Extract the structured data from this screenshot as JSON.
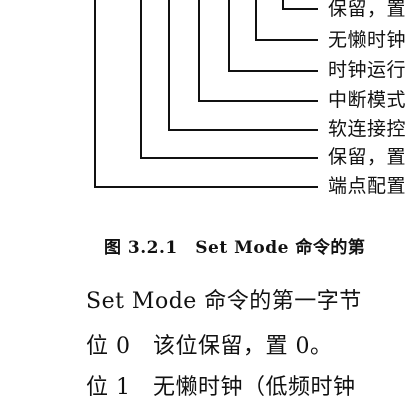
{
  "diagram": {
    "labels": [
      "保留，置",
      "无懒时钟",
      "时钟运行",
      "中断模式",
      "软连接控",
      "保留，置",
      "端点配置"
    ]
  },
  "figure": {
    "caption": "图 3.2.1　Set Mode 命令的第"
  },
  "body": {
    "line1": "Set Mode 命令的第一字节",
    "line2": "位 0　该位保留，置 0。",
    "line3": "位 1　无懒时钟（低频时钟"
  }
}
